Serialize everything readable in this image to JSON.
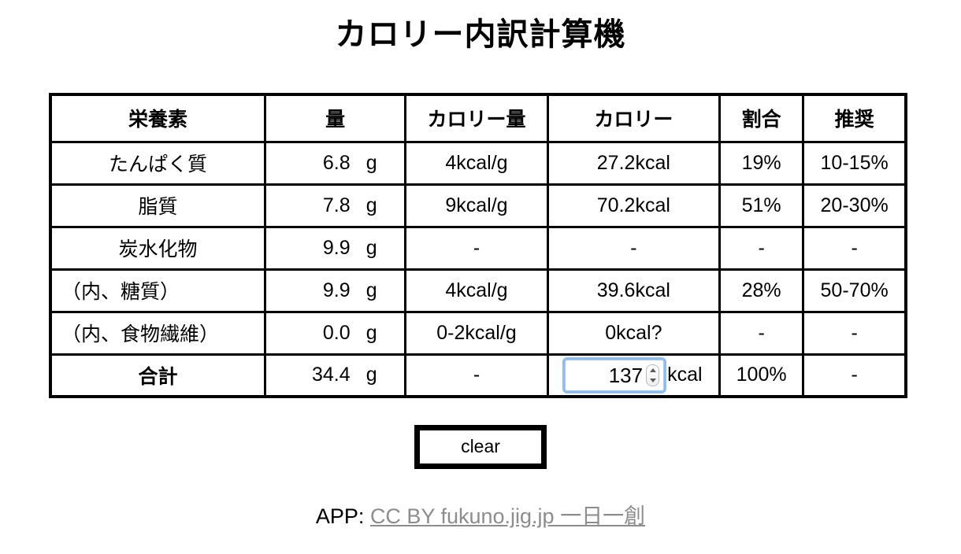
{
  "page": {
    "title": "カロリー内訳計算機"
  },
  "table": {
    "headers": {
      "nutrient": "栄養素",
      "amount": "量",
      "kcal_per_g": "カロリー量",
      "calories": "カロリー",
      "ratio": "割合",
      "recommended": "推奨"
    },
    "rows": [
      {
        "name": "たんぱく質",
        "amount_value": "6.8",
        "amount_unit": "g",
        "kcal_per_g": "4kcal/g",
        "calories": "27.2kcal",
        "ratio": "19%",
        "ratio_highlight": "red",
        "recommended": "10-15%"
      },
      {
        "name": "脂質",
        "amount_value": "7.8",
        "amount_unit": "g",
        "kcal_per_g": "9kcal/g",
        "calories": "70.2kcal",
        "ratio": "51%",
        "ratio_highlight": "red",
        "recommended": "20-30%"
      },
      {
        "name": "炭水化物",
        "amount_value": "9.9",
        "amount_unit": "g",
        "kcal_per_g": "-",
        "calories": "-",
        "ratio": "-",
        "ratio_highlight": "none",
        "recommended": "-"
      },
      {
        "name": "（内、糖質）",
        "amount_value": "9.9",
        "amount_unit": "g",
        "kcal_per_g": "4kcal/g",
        "calories": "39.6kcal",
        "ratio": "28%",
        "ratio_highlight": "blue",
        "recommended": "50-70%"
      },
      {
        "name": "（内、食物繊維）",
        "amount_value": "0.0",
        "amount_unit": "g",
        "kcal_per_g": "0-2kcal/g",
        "calories": "0kcal?",
        "ratio": "-",
        "ratio_highlight": "none",
        "recommended": "-"
      }
    ],
    "total_row": {
      "name": "合計",
      "amount_value": "34.4",
      "amount_unit": "g",
      "kcal_per_g": "-",
      "calories_input_value": "137",
      "calories_suffix": "kcal",
      "ratio": "100%",
      "recommended": "-"
    }
  },
  "controls": {
    "clear_label": "clear"
  },
  "footer": {
    "prefix": "APP: ",
    "link_text": "CC BY fukuno.jig.jp 一日一創"
  },
  "colors": {
    "highlight_red": "#fa6a6a",
    "highlight_blue": "#6699fa",
    "focus_ring": "#6aa8e8",
    "link_gray": "#8c8c8c",
    "border": "#000000"
  }
}
